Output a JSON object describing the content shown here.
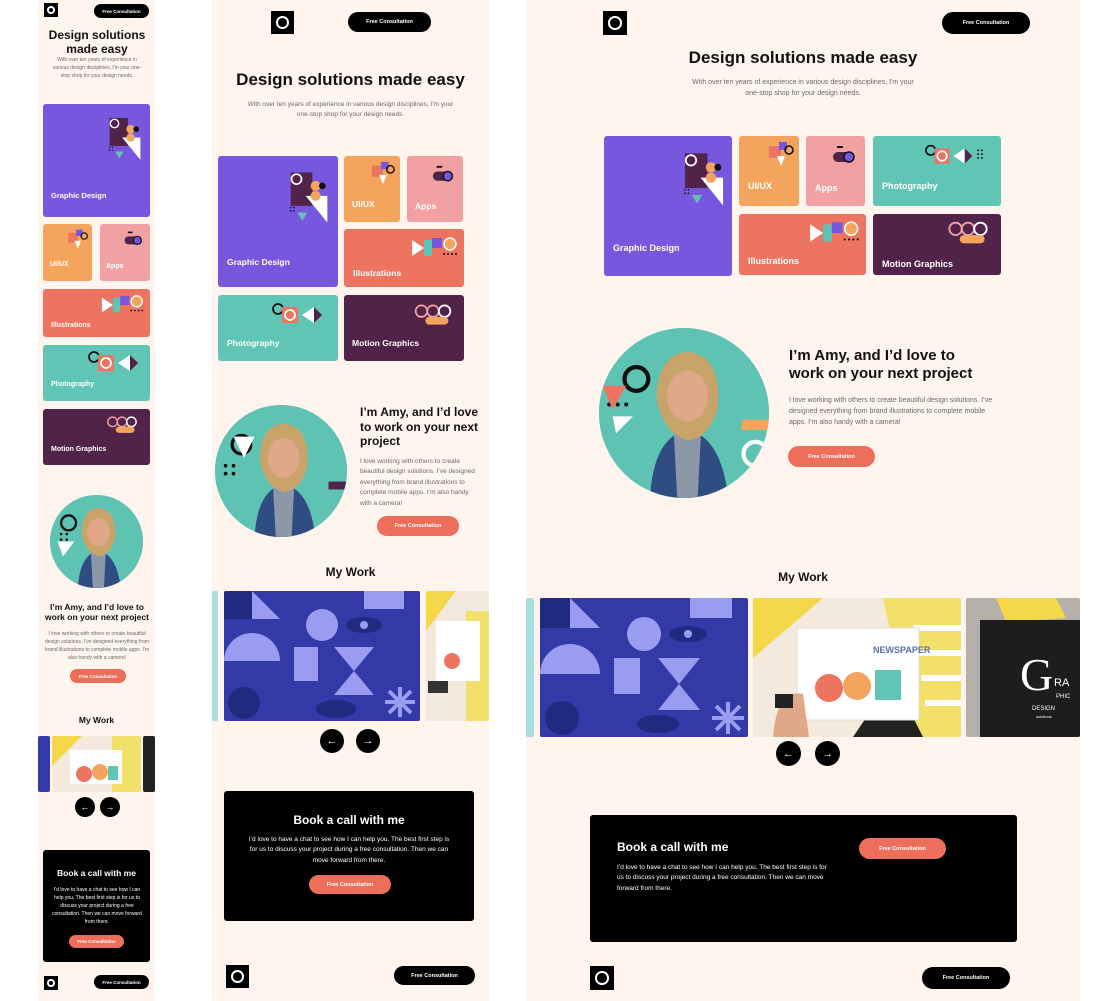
{
  "brand": {
    "cta_label": "Free Consultation"
  },
  "hero": {
    "title": "Design solutions made easy",
    "subtitle": "With over ten years of experience in various design disciplines, I'm your one-stop shop for your design needs."
  },
  "services": [
    {
      "label": "Graphic Design",
      "icon": "graphic-design-illustration"
    },
    {
      "label": "UI/UX",
      "icon": "ui-ux-illustration"
    },
    {
      "label": "Apps",
      "icon": "apps-illustration"
    },
    {
      "label": "Illustrations",
      "icon": "illustrations-illustration"
    },
    {
      "label": "Photography",
      "icon": "photography-illustration"
    },
    {
      "label": "Motion Graphics",
      "icon": "motion-graphics-illustration"
    }
  ],
  "about": {
    "title": "I’m Amy, and I’d love to work on your next project",
    "body": "I love working with others to create beautiful design solutions. I’ve designed everything from brand illustrations to complete mobile apps. I’m also handy with a camera!",
    "cta_label": "Free Consultation"
  },
  "work": {
    "title": "My Work",
    "slides": [
      "Geometric shapes pattern",
      "Newspaper illustration",
      "Graphic tote bag"
    ],
    "newspaper_text": "NEWSPAPER",
    "tote_letter": "G",
    "tote_words": [
      "RA",
      "PHIC",
      "DESIGN",
      "solutions"
    ],
    "prev_icon": "arrow-left-icon",
    "next_icon": "arrow-right-icon"
  },
  "book": {
    "title": "Book a call with me",
    "body": "I’d love to have a chat to see how I can help you. The best first step is for us to discuss your project during a free consultation. Then we can move forward from there.",
    "cta_label": "Free Consultation"
  },
  "colors": {
    "background": "#fff4ee",
    "graphic_design": "#7657de",
    "ui_ux": "#f4a45d",
    "apps": "#f2a1a3",
    "illustrations": "#ed7461",
    "photography": "#61c5b5",
    "motion_graphics": "#512348",
    "accent": "#ed6e5b"
  }
}
